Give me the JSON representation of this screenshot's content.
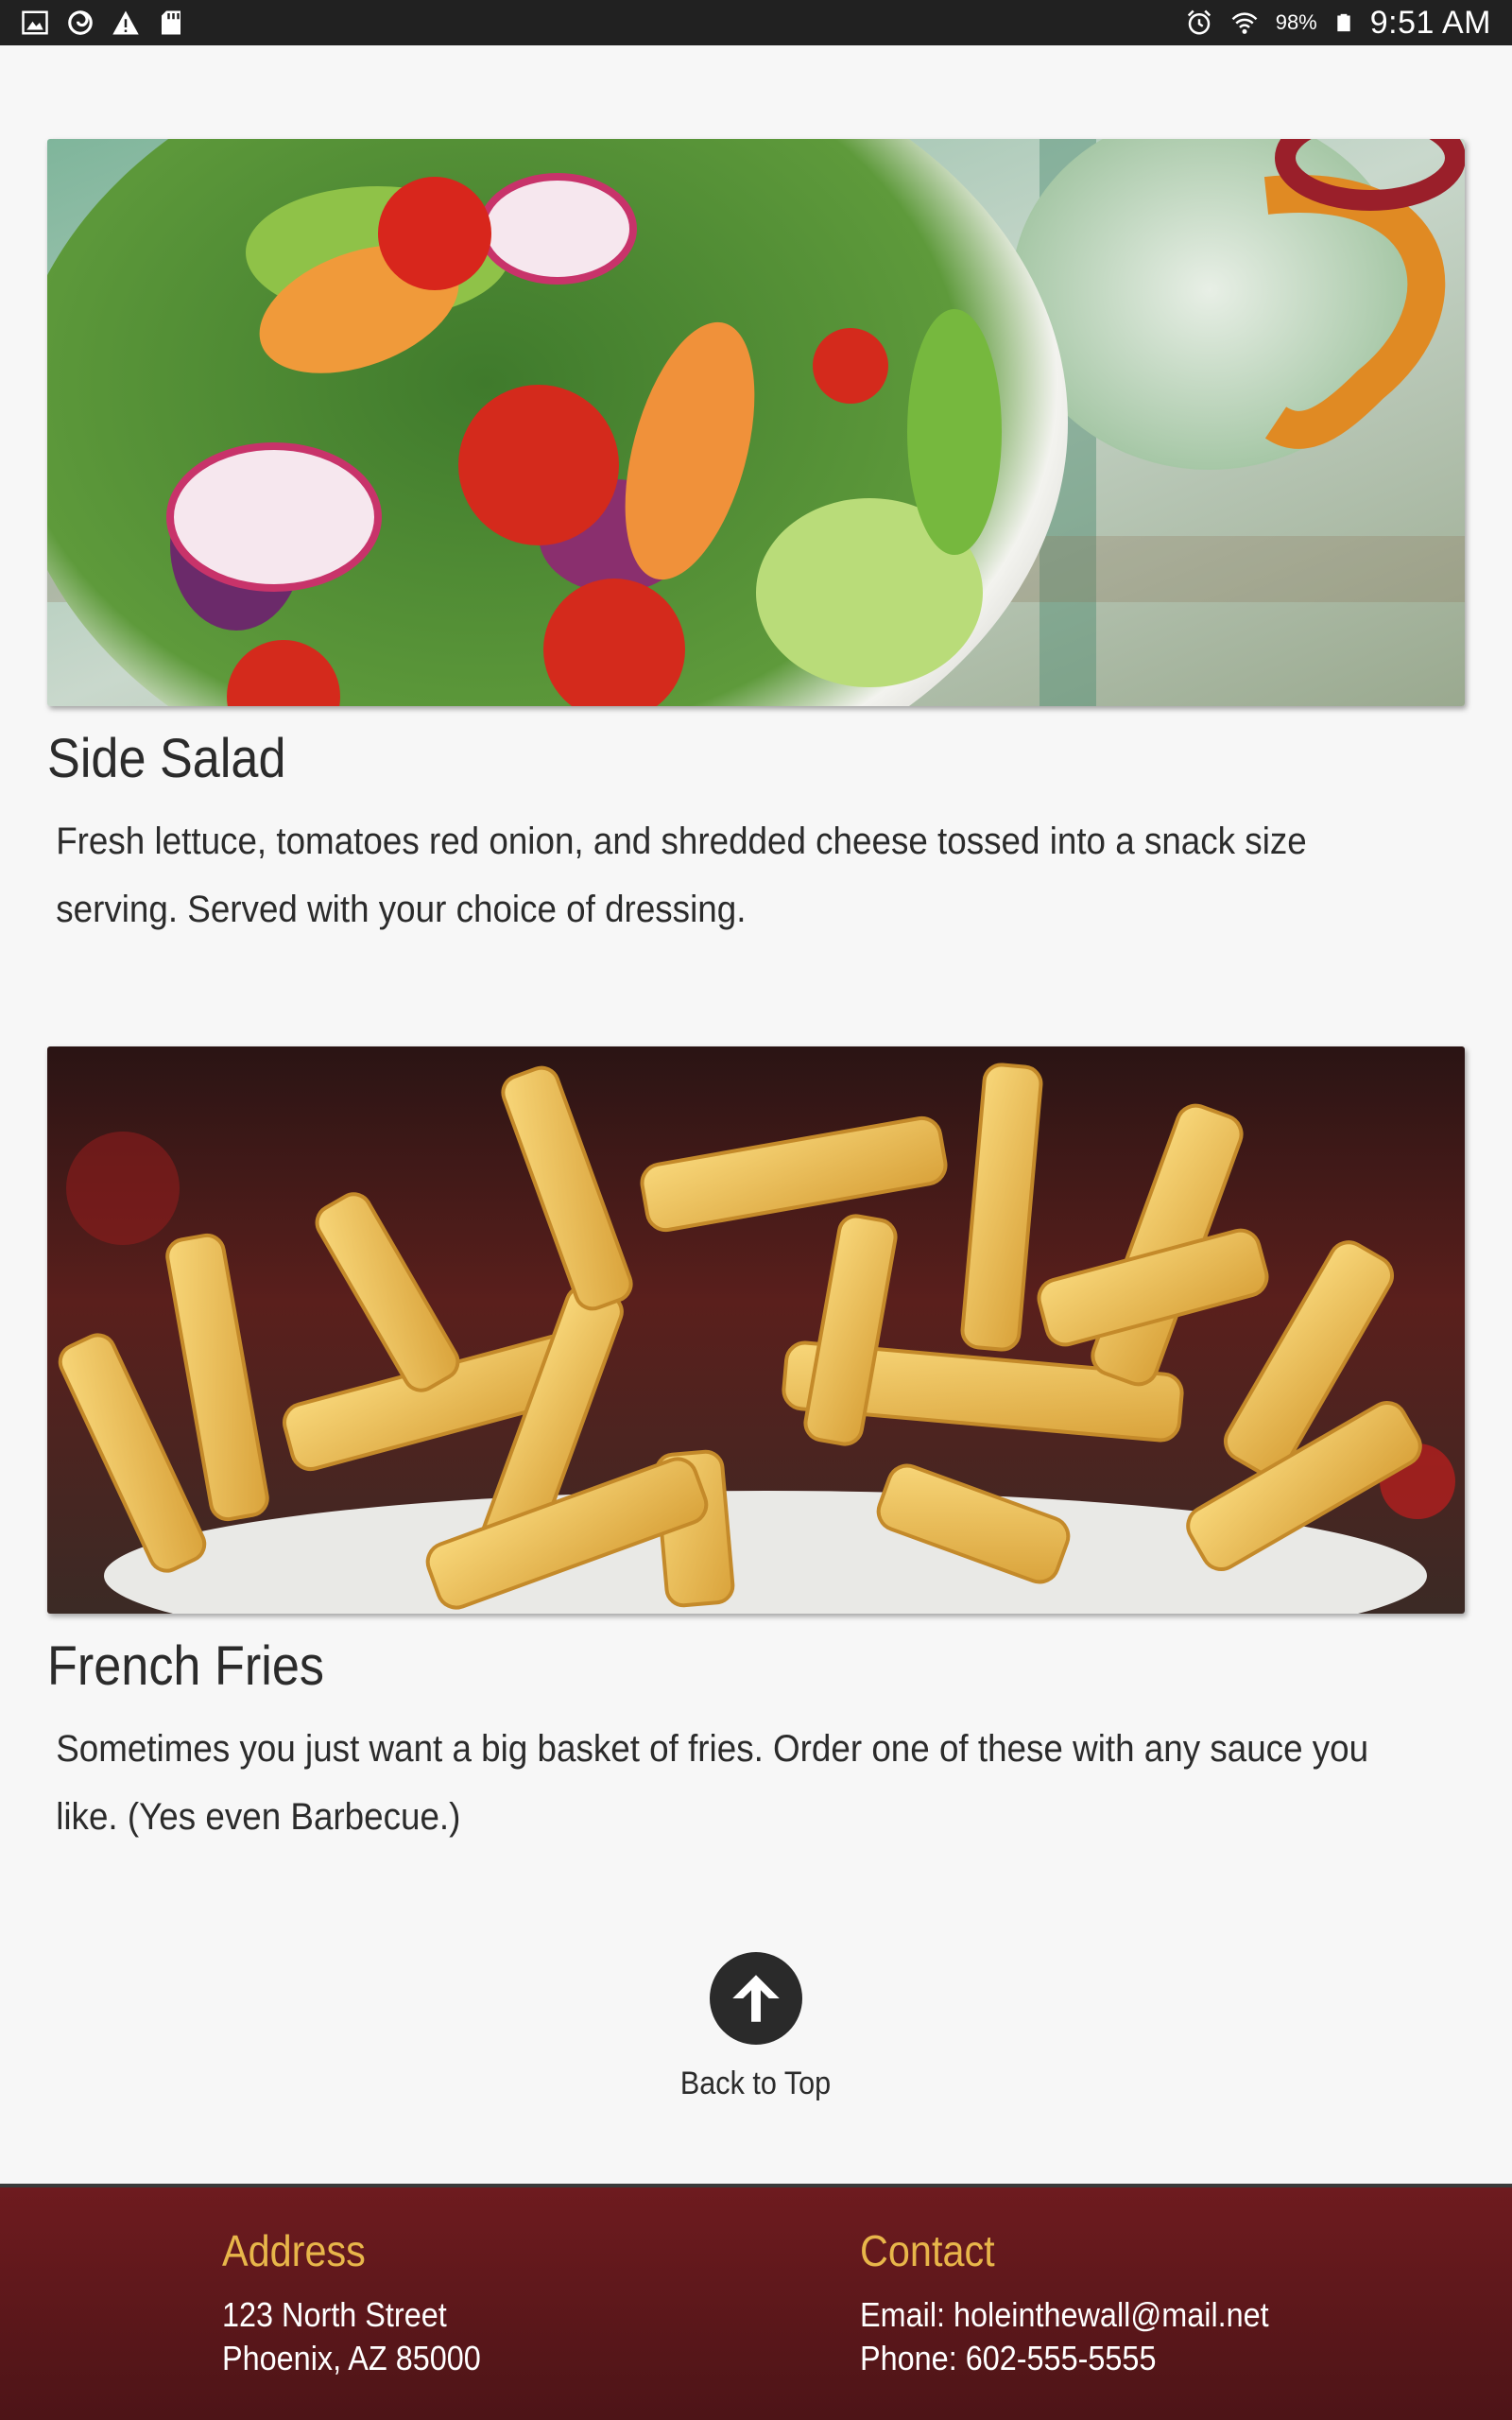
{
  "status_bar": {
    "left_icons": [
      "gallery-icon",
      "firefox-icon",
      "warning-icon",
      "sd-card-icon"
    ],
    "right_icons": [
      "alarm-icon",
      "wifi-icon",
      "battery-icon"
    ],
    "battery": "98%",
    "time": "9:51 AM"
  },
  "menu": {
    "items": [
      {
        "image": "salad-photo",
        "title": "Side Salad",
        "description": "Fresh lettuce, tomatoes red onion, and shredded cheese tossed into a snack size serving. Served with your choice of dressing."
      },
      {
        "image": "fries-photo",
        "title": "French Fries",
        "description": "Sometimes you just want a big basket of fries. Order one of these with any sauce you like. (Yes even Barbecue.)"
      }
    ]
  },
  "back_to_top": {
    "icon": "arrow-up-icon",
    "label": "Back to Top"
  },
  "footer": {
    "address": {
      "heading": "Address",
      "line1": "123 North Street",
      "line2": "Phoenix, AZ 85000"
    },
    "contact": {
      "heading": "Contact",
      "line1": "Email: holeinthewall@mail.net",
      "line2": "Phone: 602-555-5555"
    },
    "colors": {
      "background": "#6e1b1f",
      "heading": "#e8b64a"
    }
  }
}
